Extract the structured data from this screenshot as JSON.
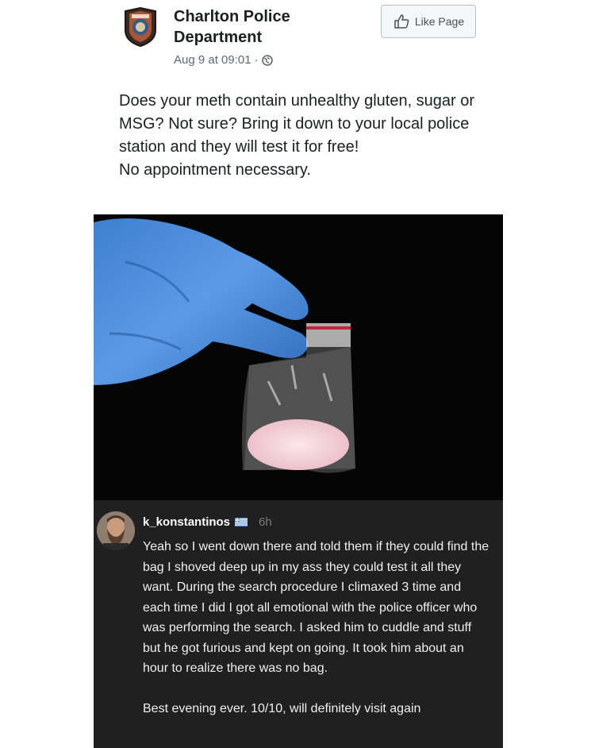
{
  "post": {
    "page_name": "Charlton Police Department",
    "like_button": "Like Page",
    "timestamp": "Aug 9 at 09:01",
    "separator": "·",
    "text_lines": [
      "Does your meth contain unhealthy gluten, sugar or MSG? Not sure? Bring it down to your local police station and they will test it for free!",
      "No appointment necessary."
    ]
  },
  "comment": {
    "username": "k_konstantinos",
    "flag": "greece-flag-icon",
    "time": "6h",
    "paragraphs": [
      "Yeah so I went down there and told them if they could find the bag I shoved deep up in my ass they could test it all they want. During the search procedure I climaxed 3 time and each time I did I got all emotional with the police officer who was performing the search. I asked him to cuddle and stuff but he got furious and kept on going. It took him about an hour to realize there was no bag.",
      "Best evening ever. 10/10, will definitely visit again"
    ]
  },
  "colors": {
    "comment_bg": "#202020",
    "glove": "#4f8fd8",
    "photo_bg": "#050505"
  }
}
